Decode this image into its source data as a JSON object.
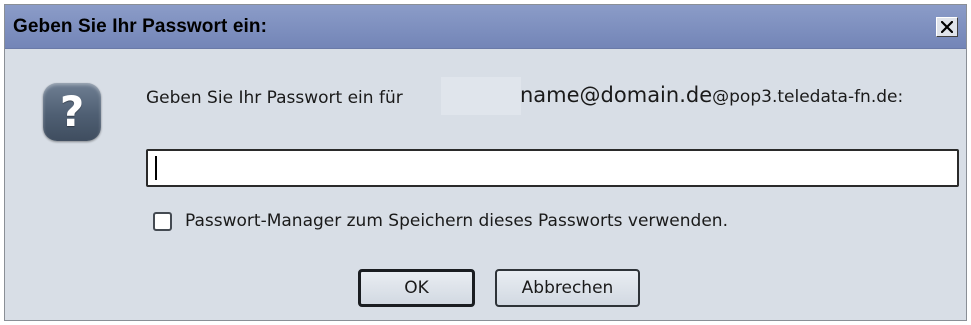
{
  "window": {
    "title": "Geben Sie Ihr Passwort ein:",
    "close_glyph": "✕"
  },
  "dialog": {
    "icon": "question-mark-icon",
    "icon_glyph": "?",
    "prompt_label": "Geben Sie Ihr Passwort ein für",
    "account_main": "name@domain.de",
    "account_rest": "@pop3.teledata-fn.de:"
  },
  "password_field": {
    "value": "",
    "placeholder": ""
  },
  "remember_checkbox": {
    "checked": false,
    "label": "Passwort-Manager zum Speichern dieses Passworts verwenden."
  },
  "buttons": {
    "ok_label": "OK",
    "cancel_label": "Abbrechen"
  },
  "colors": {
    "titlebar": "#7f91c0",
    "dialog_bg": "#d8dee6",
    "icon_bg": "#5a6a7e"
  }
}
